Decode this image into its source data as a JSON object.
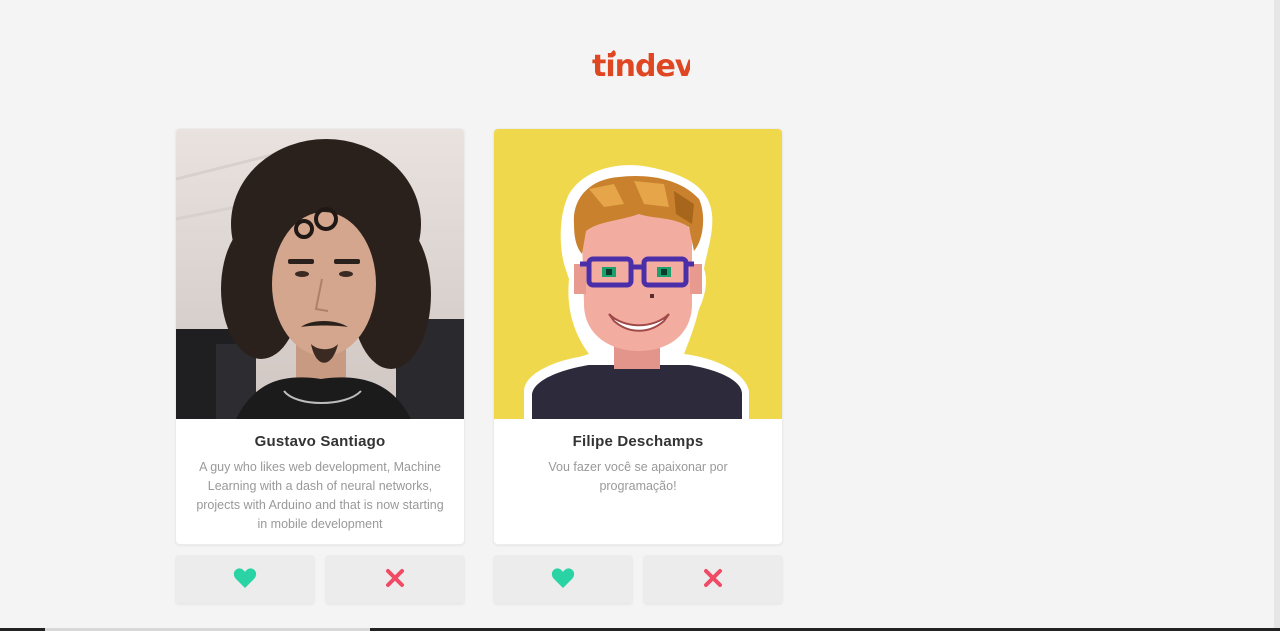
{
  "app": {
    "logo_text": "tindev",
    "brand_color": "#df4723"
  },
  "developers": [
    {
      "name": "Gustavo Santiago",
      "bio": "A guy who likes web development, Machine Learning with a dash of neural networks, projects with Arduino and that is now starting in mobile development",
      "avatar": "photo-portrait-curly-hair"
    },
    {
      "name": "Filipe Deschamps",
      "bio": "Vou fazer você se apaixonar por programação!",
      "avatar": "pixel-art-portrait-glasses"
    }
  ],
  "actions": {
    "like_icon": "heart-icon",
    "like_color": "#2ad3a4",
    "dislike_icon": "close-icon",
    "dislike_color": "#f04a65"
  }
}
